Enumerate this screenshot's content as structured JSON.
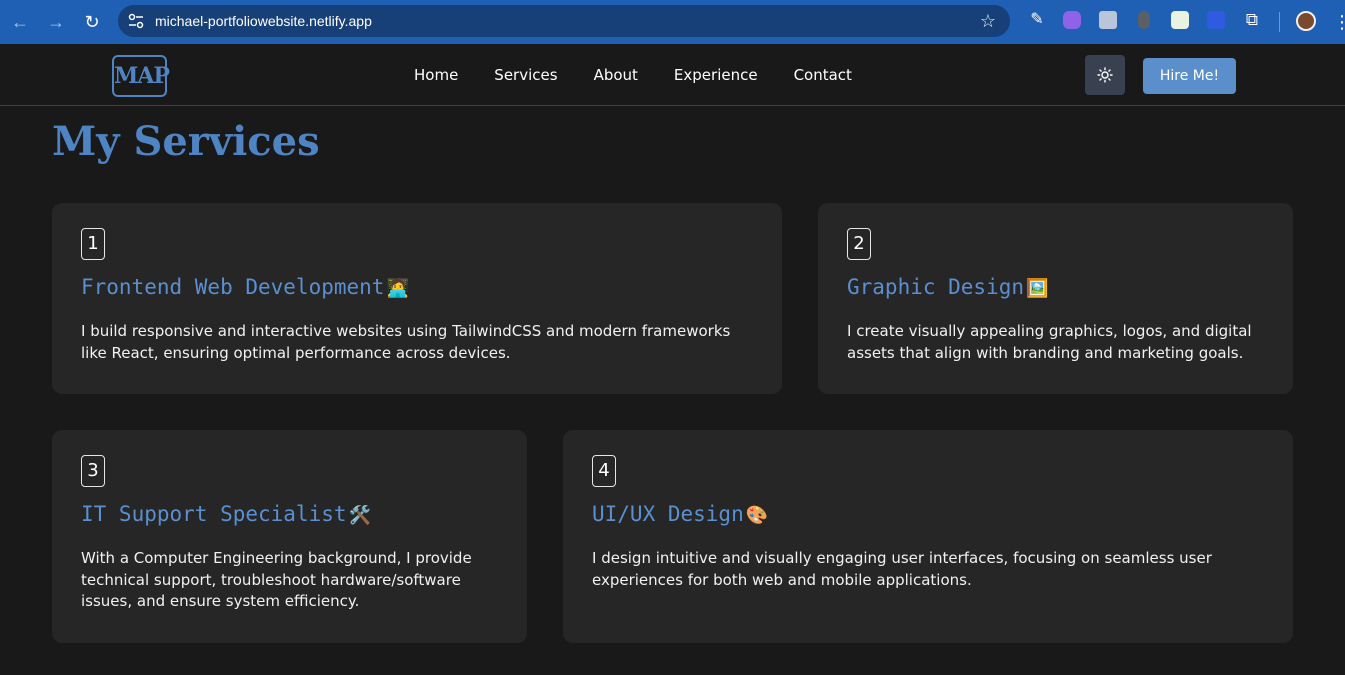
{
  "browser": {
    "url": "michael-portfoliowebsite.netlify.app",
    "icons": {
      "back": "back-arrow-icon",
      "forward": "forward-arrow-icon",
      "reload": "reload-icon",
      "site_info": "tune-icon",
      "bookmark": "star-icon",
      "extensions": "puzzle-icon",
      "menu": "kebab-icon"
    }
  },
  "site": {
    "logo_text": "MAP",
    "nav": [
      "Home",
      "Services",
      "About",
      "Experience",
      "Contact"
    ],
    "hire_label": "Hire Me!",
    "theme_icon": "sun-icon"
  },
  "section": {
    "title": "My Services",
    "cards": [
      {
        "number": "1",
        "title": "Frontend Web Development",
        "emoji": "🧑‍💻",
        "description": "I build responsive and interactive websites using TailwindCSS and modern frameworks like React, ensuring optimal performance across devices."
      },
      {
        "number": "2",
        "title": "Graphic Design",
        "emoji": "🖼️",
        "description": "I create visually appealing graphics, logos, and digital assets that align with branding and marketing goals."
      },
      {
        "number": "3",
        "title": "IT Support Specialist",
        "emoji": "🛠️",
        "description": "With a Computer Engineering background, I provide technical support, troubleshoot hardware/software issues, and ensure system efficiency."
      },
      {
        "number": "4",
        "title": "UI/UX Design",
        "emoji": "🎨",
        "description": "I design intuitive and visually engaging user interfaces, focusing on seamless user experiences for both web and mobile applications."
      }
    ]
  },
  "colors": {
    "accent": "#4f84c4",
    "background": "#191919",
    "card": "#262626",
    "chrome": "#1f5fb4"
  }
}
